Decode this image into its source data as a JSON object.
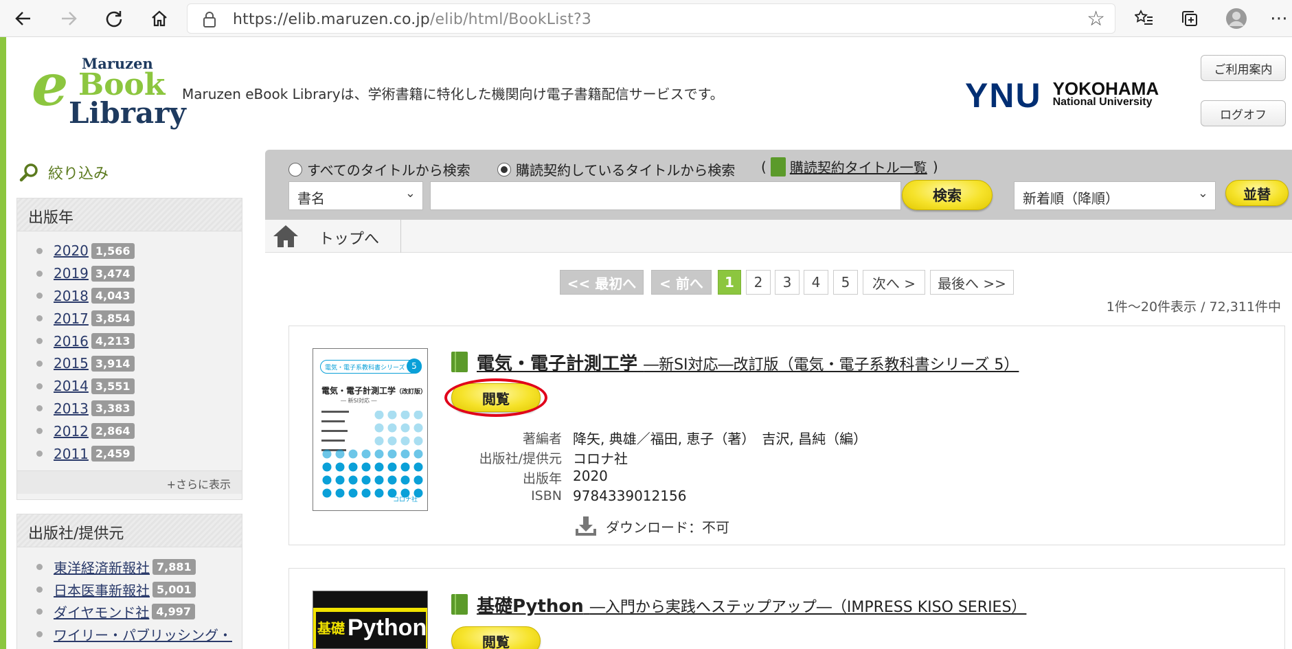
{
  "browser": {
    "url_host": "https://elib.maruzen.co.jp",
    "url_path": "/elib/html/BookList?3"
  },
  "header": {
    "logo": {
      "line1": "Maruzen",
      "line2_e": "e",
      "line2": "Book",
      "line3": "Library"
    },
    "tagline": "Maruzen eBook Libraryは、学術書籍に特化した機関向け電子書籍配信サービスです。",
    "ynu_mark": "YNU",
    "ynu_line1": "YOKOHAMA",
    "ynu_line2": "National University",
    "guide_button": "ご利用案内",
    "logout_button": "ログオフ"
  },
  "sidebar": {
    "filter_title": "絞り込み",
    "year_panel": {
      "title": "出版年",
      "items": [
        {
          "label": "2020",
          "count": "1,566"
        },
        {
          "label": "2019",
          "count": "3,474"
        },
        {
          "label": "2018",
          "count": "4,043"
        },
        {
          "label": "2017",
          "count": "3,854"
        },
        {
          "label": "2016",
          "count": "4,213"
        },
        {
          "label": "2015",
          "count": "3,914"
        },
        {
          "label": "2014",
          "count": "3,551"
        },
        {
          "label": "2013",
          "count": "3,383"
        },
        {
          "label": "2012",
          "count": "2,864"
        },
        {
          "label": "2011",
          "count": "2,459"
        }
      ],
      "more": "+さらに表示"
    },
    "publisher_panel": {
      "title": "出版社/提供元",
      "items": [
        {
          "label": "東洋経済新報社",
          "count": "7,881"
        },
        {
          "label": "日本医事新報社",
          "count": "5,001"
        },
        {
          "label": "ダイヤモンド社",
          "count": "4,997"
        },
        {
          "label": "ワイリー・パブリッシング・",
          "count": ""
        }
      ]
    }
  },
  "search": {
    "radio_all": "すべてのタイトルから検索",
    "radio_subscribed": "購読契約しているタイトルから検索",
    "subscribed_open": "(",
    "subscribed_link": "購読契約タイトル一覧",
    "subscribed_close": ")",
    "field_select": "書名",
    "query": "",
    "search_button": "検索",
    "sort_select": "新着順（降順）",
    "sort_button": "並替"
  },
  "breadcrumb": {
    "top": "トップへ"
  },
  "pager": {
    "first": "<< 最初へ",
    "prev": "< 前へ",
    "pages": [
      "1",
      "2",
      "3",
      "4",
      "5"
    ],
    "next": "次へ >",
    "last": "最後へ >>",
    "summary": "1件〜20件表示 / 72,311件中"
  },
  "results": [
    {
      "title": "電気・電子計測工学",
      "subtitle": "―新SI対応―改訂版（電気・電子系教科書シリーズ 5）",
      "view_button": "閲覧",
      "labels": {
        "author": "著編者",
        "publisher": "出版社/提供元",
        "year": "出版年",
        "isbn": "ISBN"
      },
      "author": "降矢, 典雄／福田, 恵子（著）　吉沢, 昌純（編）",
      "publisher": "コロナ社",
      "year": "2020",
      "isbn": "9784339012156",
      "download": "ダウンロード：不可",
      "cover": {
        "series": "電気・電子系教科書シリーズ",
        "num": "5",
        "title": "電気・電子計測工学",
        "edition": "（改訂版）",
        "sub": "― 新SI対応 ―",
        "publisher": "コロナ社"
      }
    },
    {
      "title": "基礎Python",
      "subtitle": "―入門から実践へステップアップ―（IMPRESS KISO SERIES）",
      "view_button": "閲覧",
      "cover": {
        "kanji": "基礎",
        "word": "Python"
      }
    }
  ],
  "colors": {
    "accent": "#8cc63f",
    "button_yellow": "#f6e32b",
    "highlight_ring": "#e0001a",
    "ynu_blue": "#002e73"
  }
}
